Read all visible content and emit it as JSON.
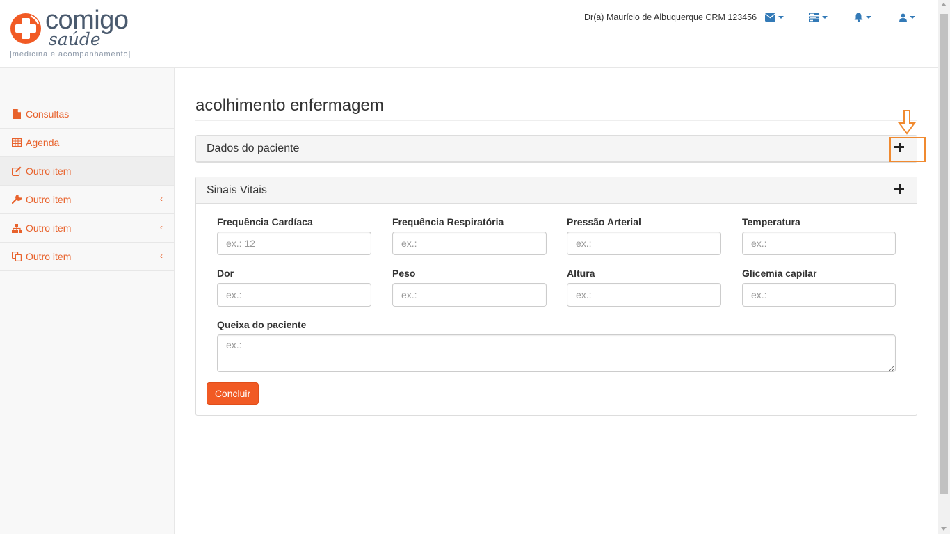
{
  "brand": {
    "word": "comigo",
    "sub": "saúde",
    "tagline": "|medicina e acompanhamento|",
    "accent": "#f15a24"
  },
  "header": {
    "user": "Dr(a) Maurício de Albuquerque CRM 123456",
    "icons": [
      "envelope-icon",
      "tasks-icon",
      "bell-icon",
      "user-icon"
    ]
  },
  "sidebar": {
    "items": [
      {
        "label": "Consultas",
        "icon": "file-icon"
      },
      {
        "label": "Agenda",
        "icon": "table-icon"
      },
      {
        "label": "Outro item",
        "icon": "edit-icon"
      },
      {
        "label": "Outro item",
        "icon": "wrench-icon"
      },
      {
        "label": "Outro item",
        "icon": "sitemap-icon"
      },
      {
        "label": "Outro item",
        "icon": "copy-icon"
      }
    ]
  },
  "main": {
    "title": "acolhimento enfermagem",
    "panel_patient": {
      "title": "Dados do paciente"
    },
    "panel_vitals": {
      "title": "Sinais Vitais",
      "fields": [
        {
          "label": "Frequência Cardíaca",
          "placeholder": "ex.: 12"
        },
        {
          "label": "Frequência Respiratória",
          "placeholder": "ex.:"
        },
        {
          "label": "Pressão Arterial",
          "placeholder": "ex.:"
        },
        {
          "label": "Temperatura",
          "placeholder": "ex.:"
        },
        {
          "label": "Dor",
          "placeholder": "ex.:"
        },
        {
          "label": "Peso",
          "placeholder": "ex.:"
        },
        {
          "label": "Altura",
          "placeholder": "ex.:"
        },
        {
          "label": "Glicemia capilar",
          "placeholder": "ex.:"
        }
      ],
      "complaint": {
        "label": "Queixa do paciente",
        "placeholder": "ex.:"
      },
      "submit": "Concluir"
    }
  }
}
